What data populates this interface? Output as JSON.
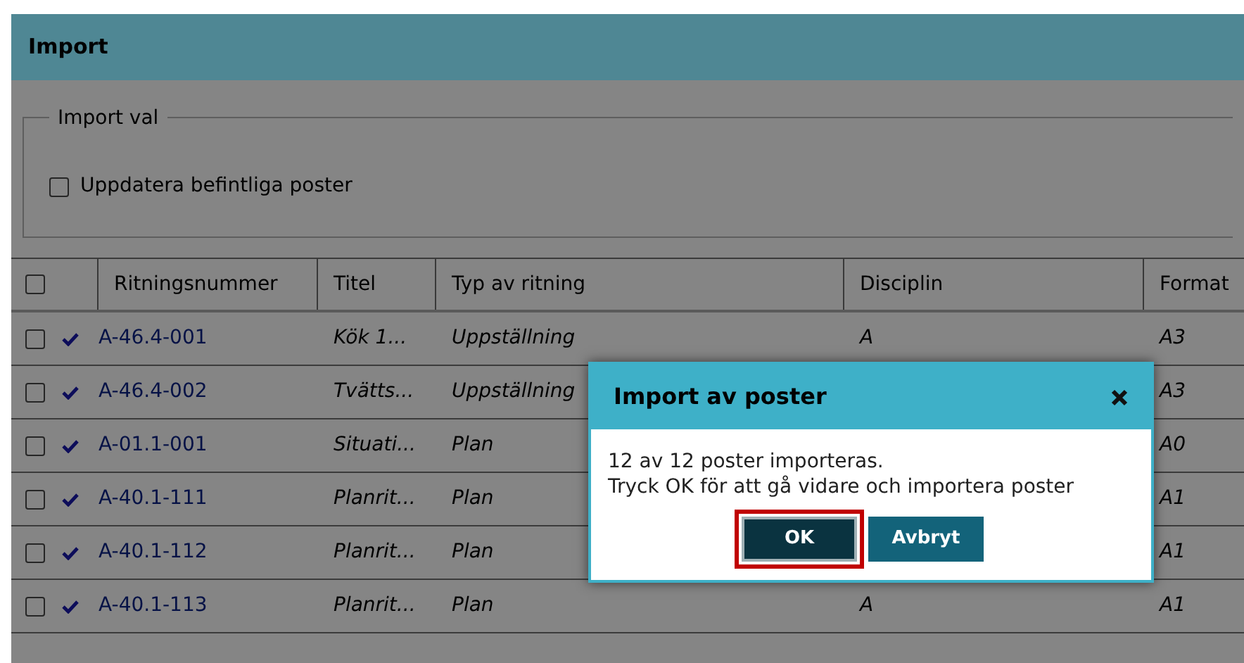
{
  "window": {
    "title": "Import"
  },
  "import_options": {
    "legend": "Import val",
    "checkbox": {
      "label": "Uppdatera befintliga poster",
      "checked": false
    }
  },
  "table": {
    "select_all": {
      "checked": false
    },
    "columns": [
      "Ritningsnummer",
      "Titel",
      "Typ av ritning",
      "Disciplin",
      "Format"
    ],
    "rows": [
      {
        "checked": false,
        "imported": true,
        "number": "A-46.4-001",
        "title": "Kök 1...",
        "type": "Uppställning",
        "discipline": "A",
        "format": "A3"
      },
      {
        "checked": false,
        "imported": true,
        "number": "A-46.4-002",
        "title": "Tvätts...",
        "type": "Uppställning",
        "format": "A3"
      },
      {
        "checked": false,
        "imported": true,
        "number": "A-01.1-001",
        "title": "Situati...",
        "type": "Plan",
        "format": "A0"
      },
      {
        "checked": false,
        "imported": true,
        "number": "A-40.1-111",
        "title": "Planrit...",
        "type": "Plan",
        "format": "A1"
      },
      {
        "checked": false,
        "imported": true,
        "number": "A-40.1-112",
        "title": "Planrit...",
        "type": "Plan",
        "format": "A1"
      },
      {
        "checked": false,
        "imported": true,
        "number": "A-40.1-113",
        "title": "Planrit...",
        "type": "Plan",
        "discipline": "A",
        "format": "A1"
      }
    ]
  },
  "dialog": {
    "title": "Import av poster",
    "message": [
      "12 av 12 poster importeras.",
      "Tryck OK för att gå vidare och importera poster"
    ],
    "buttons": [
      {
        "label": "OK",
        "kind": "primary",
        "selected": true
      },
      {
        "label": "Avbryt",
        "kind": "secondary",
        "selected": false
      }
    ]
  }
}
